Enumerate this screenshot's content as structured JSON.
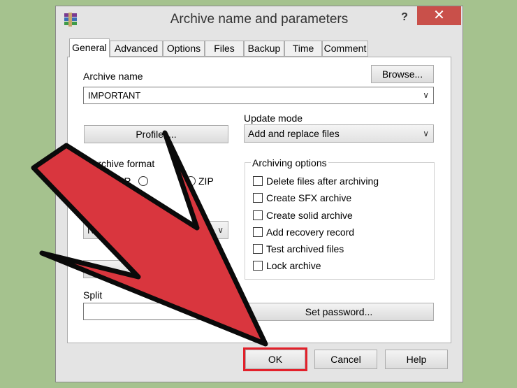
{
  "window": {
    "title": "Archive name and parameters",
    "help_label": "?",
    "close_label": "✕"
  },
  "tabs": [
    {
      "label": "General",
      "active": true
    },
    {
      "label": "Advanced"
    },
    {
      "label": "Options"
    },
    {
      "label": "Files"
    },
    {
      "label": "Backup"
    },
    {
      "label": "Time"
    },
    {
      "label": "Comment"
    }
  ],
  "general": {
    "archive_name_label": "Archive name",
    "browse_label": "Browse...",
    "archive_name_value": "IMPORTANT",
    "profiles_label": "Profiles...",
    "update_mode_label": "Update mode",
    "update_mode_value": "Add and replace files",
    "archive_format_label": "Archive format",
    "format_rar": "RAR",
    "format_zip": "ZIP",
    "compression_value": "Normal",
    "archiving_options_label": "Archiving options",
    "options": [
      {
        "label": "Delete files after archiving",
        "checked": false
      },
      {
        "label": "Create SFX archive",
        "checked": false
      },
      {
        "label": "Create solid archive",
        "checked": false
      },
      {
        "label": "Add recovery record",
        "checked": false
      },
      {
        "label": "Test archived files",
        "checked": false
      },
      {
        "label": "Lock archive",
        "checked": false
      }
    ],
    "split_label": "Split",
    "set_password_label": "Set password..."
  },
  "footer": {
    "ok_label": "OK",
    "cancel_label": "Cancel",
    "help_label": "Help"
  },
  "colors": {
    "background": "#a5c28e",
    "close_button": "#c9504a",
    "highlight_frame": "#e3202a",
    "arrow": "#d9363e"
  }
}
